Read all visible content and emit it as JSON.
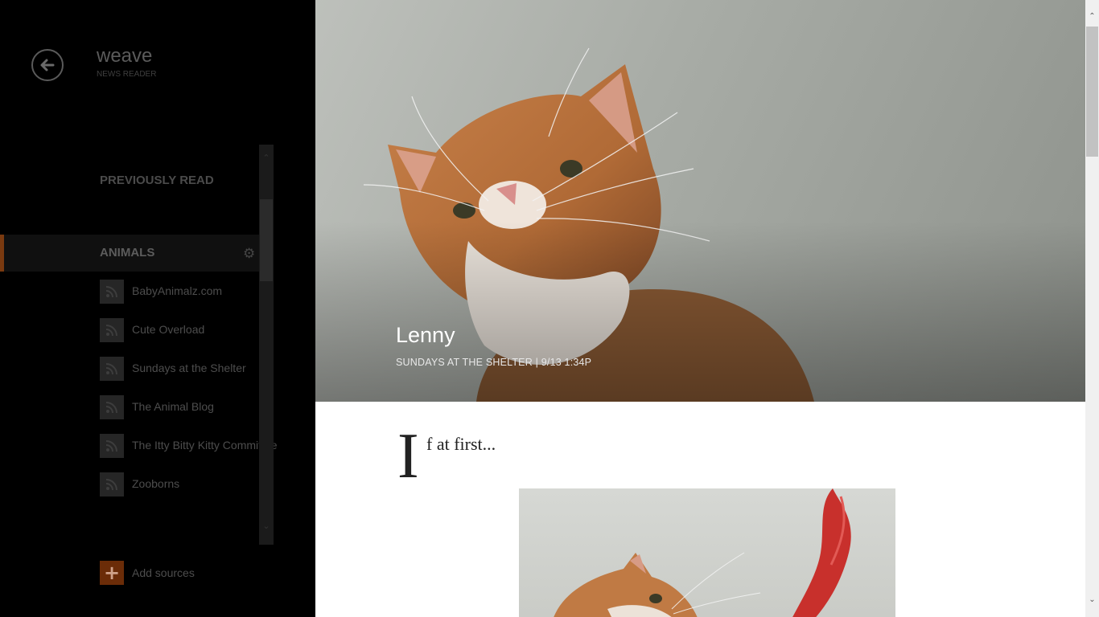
{
  "app": {
    "title": "weave",
    "subtitle": "NEWS READER"
  },
  "sidebar": {
    "previously_read": "PREVIOUSLY READ",
    "category": "ANIMALS",
    "feeds": [
      {
        "name": "BabyAnimalz.com",
        "icon": "rss-icon"
      },
      {
        "name": "Cute Overload",
        "icon": "rss-icon"
      },
      {
        "name": "Sundays at the Shelter",
        "icon": "rss-icon"
      },
      {
        "name": "The Animal Blog",
        "icon": "rss-icon"
      },
      {
        "name": "The Itty Bitty Kitty Committee",
        "icon": "rss-icon"
      },
      {
        "name": "Zooborns",
        "icon": "rss-icon"
      }
    ],
    "add_sources": "Add sources"
  },
  "article": {
    "title": "Lenny",
    "meta": "SUNDAYS AT THE SHELTER | 9/13 1:34P",
    "dropcap": "I",
    "lead_text": "f at first..."
  },
  "colors": {
    "accent": "#7a3a10",
    "add_button": "#6b2c08",
    "sidebar_bg": "#000000",
    "article_bg": "#ffffff"
  }
}
